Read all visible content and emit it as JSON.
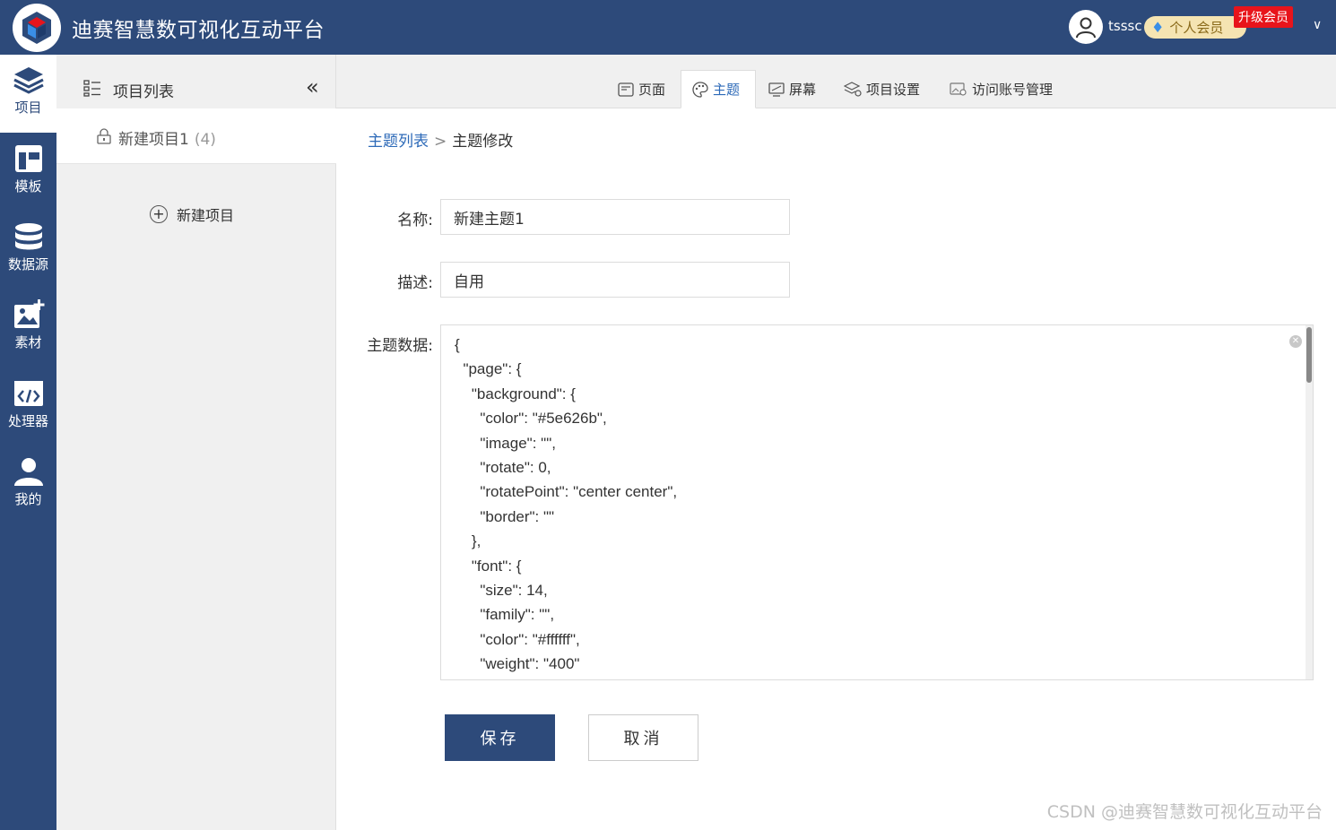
{
  "app": {
    "title": "迪赛智慧数可视化互动平台"
  },
  "user": {
    "name": "tsssc",
    "member_label": "个人会员",
    "upgrade_label": "升级会员",
    "dropdown": "∨"
  },
  "leftnav": [
    {
      "label": "项目",
      "icon": "layers-icon"
    },
    {
      "label": "模板",
      "icon": "template-icon"
    },
    {
      "label": "数据源",
      "icon": "database-icon"
    },
    {
      "label": "素材",
      "icon": "image-add-icon"
    },
    {
      "label": "处理器",
      "icon": "code-icon"
    },
    {
      "label": "我的",
      "icon": "user-icon"
    }
  ],
  "project_panel": {
    "title": "项目列表",
    "collapse": "«",
    "project_name": "新建项目1",
    "project_count": "(4)",
    "new_project": "新建项目"
  },
  "tabs": [
    {
      "label": "页面"
    },
    {
      "label": "主题"
    },
    {
      "label": "屏幕"
    },
    {
      "label": "项目设置"
    },
    {
      "label": "访问账号管理"
    }
  ],
  "breadcrumb": {
    "parent": "主题列表",
    "separator": ">",
    "current": "主题修改"
  },
  "form": {
    "name_label": "名称:",
    "name_value": "新建主题1",
    "desc_label": "描述:",
    "desc_value": "自用",
    "data_label": "主题数据:",
    "data_value": "{\n  \"page\": {\n    \"background\": {\n      \"color\": \"#5e626b\",\n      \"image\": \"\",\n      \"rotate\": 0,\n      \"rotatePoint\": \"center center\",\n      \"border\": \"\"\n    },\n    \"font\": {\n      \"size\": 14,\n      \"family\": \"\",\n      \"color\": \"#ffffff\",\n      \"weight\": \"400\""
  },
  "buttons": {
    "save": "保存",
    "cancel": "取消"
  },
  "watermark": "CSDN @迪赛智慧数可视化互动平台",
  "colors": {
    "primary": "#2d4a7a",
    "link": "#2d6ab8",
    "upgrade": "#e8141b"
  }
}
